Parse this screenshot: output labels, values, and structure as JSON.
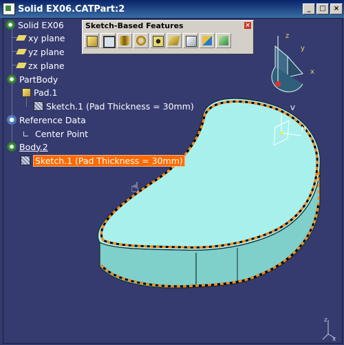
{
  "window": {
    "title": "Solid EX06.CATPart:2",
    "buttons": [
      "_",
      "□",
      "×"
    ]
  },
  "tree": {
    "root": "Solid EX06",
    "planes": [
      "xy plane",
      "yz plane",
      "zx plane"
    ],
    "partbody": "PartBody",
    "pad": "Pad.1",
    "pad_sketch": "Sketch.1 (Pad Thickness = 30mm)",
    "reference_data": "Reference Data",
    "center_point": "Center Point",
    "body2": "Body.2",
    "body2_sketch": "Sketch.1 (Pad Thickness = 30mm)"
  },
  "toolbar": {
    "title": "Sketch-Based Features",
    "close": "×",
    "buttons": [
      "pad-icon",
      "pocket-icon",
      "shaft-icon",
      "groove-icon",
      "hole-icon",
      "rib-icon",
      "slot-icon",
      "stiffener-icon",
      "multi-section-icon"
    ]
  },
  "compass": {
    "labels": [
      "z",
      "y",
      "x"
    ]
  },
  "sketch_axes": {
    "labels": [
      "V",
      "H"
    ]
  },
  "corner_axes": {
    "labels": [
      "z",
      "x"
    ]
  },
  "colors": {
    "background": "#353b6f",
    "solid_top": "#a8f0ec",
    "solid_side": "#7fcfcb",
    "sketch_edge": "#ff8c1a",
    "selection": "#ff6a00"
  }
}
